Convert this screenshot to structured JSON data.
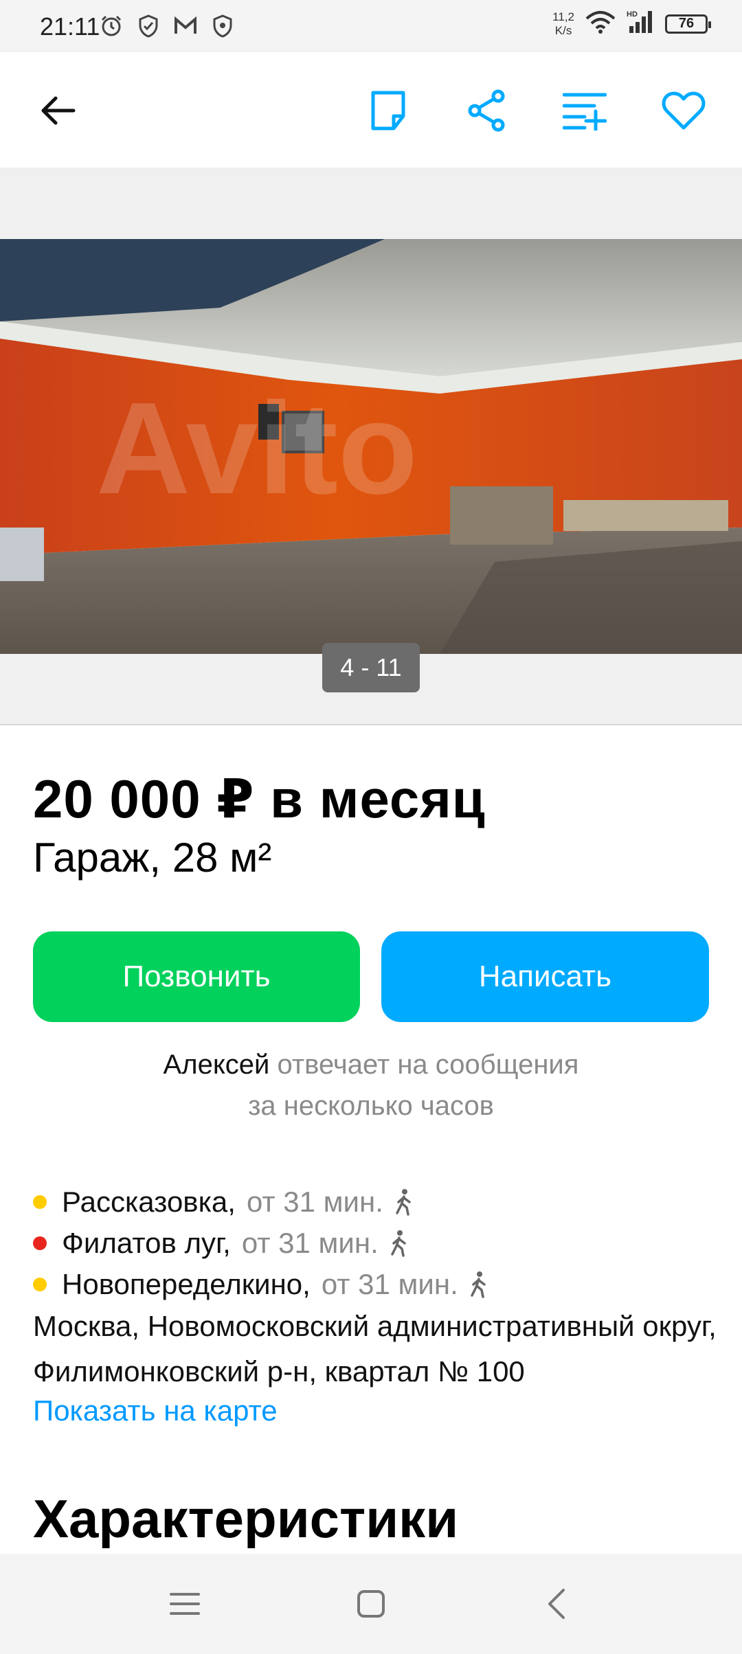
{
  "status_bar": {
    "time": "21:11",
    "net_speed": "11,2",
    "net_unit": "K/s",
    "battery": "76",
    "icons": [
      "alarm-icon",
      "shield-icon",
      "gmail-icon",
      "shield-icon",
      "wifi-icon",
      "hd-signal-icon"
    ]
  },
  "toolbar": {
    "icons": [
      "back-arrow-icon",
      "note-icon",
      "share-icon",
      "compare-list-icon",
      "favorite-heart-icon"
    ],
    "accent_color": "#00aaff"
  },
  "gallery": {
    "counter": "4 - 11",
    "watermark": "Avito"
  },
  "listing": {
    "price": "20 000 ₽ в месяц",
    "subtitle": "Гараж, 28 м²",
    "call_button": "Позвонить",
    "write_button": "Написать",
    "call_color": "#02d15c",
    "write_color": "#00aaff",
    "seller_name": "Алексей",
    "reply_text": "отвечает на сообщения",
    "reply_text_2": "за несколько часов"
  },
  "location": {
    "metro": [
      {
        "station": "Рассказовка,",
        "time": "от 31 мин.",
        "color": "#ffcc00"
      },
      {
        "station": "Филатов луг,",
        "time": "от 31 мин.",
        "color": "#e8261e"
      },
      {
        "station": "Новопеределкино,",
        "time": "от 31 мин.",
        "color": "#ffcc00"
      }
    ],
    "address": "Москва, Новомосковский административный округ, Филимонковский р-н, квартал № 100",
    "map_link": "Показать на карте"
  },
  "sections": {
    "characteristics": "Характеристики"
  },
  "nav_bar": {
    "icons": [
      "menu-icon",
      "home-square-icon",
      "back-chevron-icon"
    ]
  }
}
